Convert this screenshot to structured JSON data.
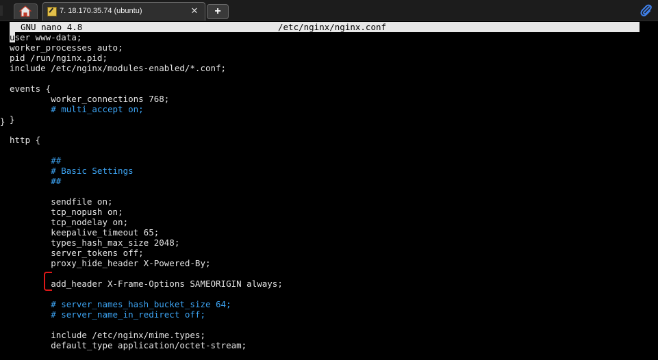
{
  "tabbar": {
    "home_icon": "home-icon",
    "tab_title": "7. 18.170.35.74 (ubuntu)",
    "tab_icon": "terminal-session-icon",
    "close_glyph": "✕",
    "new_tab_glyph": "+",
    "attach_icon": "paperclip-icon"
  },
  "editor": {
    "app": "GNU nano 4.8",
    "filename": "/etc/nginx/nginx.conf"
  },
  "file_lines": [
    {
      "text": "user www-data;",
      "type": "normal"
    },
    {
      "text": "worker_processes auto;",
      "type": "normal"
    },
    {
      "text": "pid /run/nginx.pid;",
      "type": "normal"
    },
    {
      "text": "include /etc/nginx/modules-enabled/*.conf;",
      "type": "normal"
    },
    {
      "text": "",
      "type": "normal"
    },
    {
      "text": "events {",
      "type": "normal"
    },
    {
      "text": "        worker_connections 768;",
      "type": "normal"
    },
    {
      "text": "        # multi_accept on;",
      "type": "comment"
    },
    {
      "text": "}",
      "type": "normal"
    },
    {
      "text": "",
      "type": "normal"
    },
    {
      "text": "http {",
      "type": "normal"
    },
    {
      "text": "",
      "type": "normal"
    },
    {
      "text": "        ##",
      "type": "comment"
    },
    {
      "text": "        # Basic Settings",
      "type": "comment"
    },
    {
      "text": "        ##",
      "type": "comment"
    },
    {
      "text": "",
      "type": "normal"
    },
    {
      "text": "        sendfile on;",
      "type": "normal"
    },
    {
      "text": "        tcp_nopush on;",
      "type": "normal"
    },
    {
      "text": "        tcp_nodelay on;",
      "type": "normal"
    },
    {
      "text": "        keepalive_timeout 65;",
      "type": "normal"
    },
    {
      "text": "        types_hash_max_size 2048;",
      "type": "normal"
    },
    {
      "text": "        server_tokens off;",
      "type": "normal"
    },
    {
      "text": "        proxy_hide_header X-Powered-By;",
      "type": "normal"
    },
    {
      "text": "",
      "type": "normal"
    },
    {
      "text": "        add_header X-Frame-Options SAMEORIGIN always;",
      "type": "normal"
    },
    {
      "text": "",
      "type": "normal"
    },
    {
      "text": "        # server_names_hash_bucket_size 64;",
      "type": "comment"
    },
    {
      "text": "        # server_name_in_redirect off;",
      "type": "comment"
    },
    {
      "text": "",
      "type": "normal"
    },
    {
      "text": "        include /etc/nginx/mime.types;",
      "type": "normal"
    },
    {
      "text": "        default_type application/octet-stream;",
      "type": "normal"
    }
  ],
  "side_brace": "}",
  "colors": {
    "comment": "#3da5f5",
    "text": "#e6e6e6",
    "title_bar_bg": "#e8e8e8",
    "annotation": "#e01818"
  }
}
